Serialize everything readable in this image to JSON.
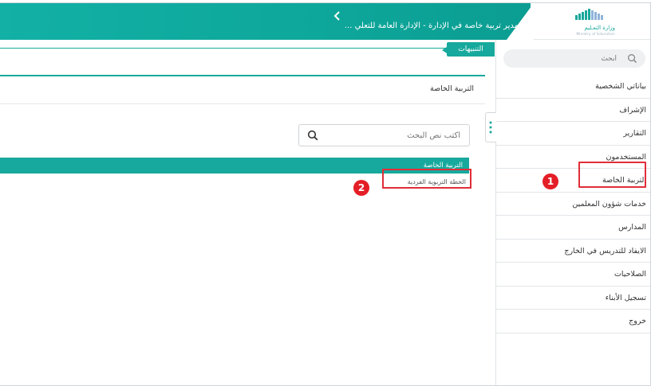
{
  "header": {
    "title": "مدير تربية خاصة في الإدارة - الإدارة العامة للتعلي ...",
    "logo_text": "وزارة التعـليم",
    "logo_sub": "Ministry of Education",
    "back_icon": "chevron-left-icon"
  },
  "notifications": {
    "label": "التنبيهات"
  },
  "sidebar": {
    "search_placeholder": "ابحث",
    "items": [
      {
        "label": "بياناتي الشخصية"
      },
      {
        "label": "الإشراف"
      },
      {
        "label": "التقارير"
      },
      {
        "label": "المستخدمون"
      },
      {
        "label": "التربية الخاصة"
      },
      {
        "label": "خدمات شؤون المعلمين"
      },
      {
        "label": "المدارس"
      },
      {
        "label": "الايفاد للتدريس في الخارج"
      },
      {
        "label": "الصلاحيات"
      },
      {
        "label": "تسجيل الأبناء"
      },
      {
        "label": "خروج"
      }
    ]
  },
  "main": {
    "page_title": "التربية الخاصة",
    "search_placeholder": "اكتب نص البحث",
    "section": {
      "title": "التربية الخاصة",
      "items": [
        {
          "label": "الخطة التربوية الفردية"
        }
      ]
    }
  },
  "annotations": {
    "badge1": "1",
    "badge2": "2"
  },
  "colors": {
    "brand": "#17a99d",
    "highlight": "#e02e38",
    "badge": "#e41e26"
  }
}
